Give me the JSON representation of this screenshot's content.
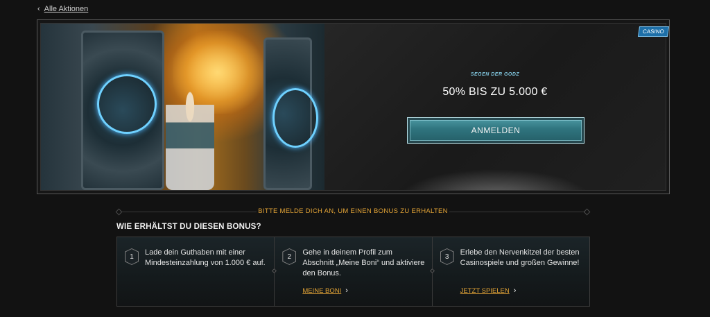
{
  "nav": {
    "back_label": "Alle Aktionen"
  },
  "promo": {
    "badge": "CASINO",
    "subtitle": "SEGEN DER GODZ",
    "headline": "50% BIS ZU 5.000 €",
    "cta_label": "ANMELDEN"
  },
  "notice": "BITTE MELDE DICH AN, UM EINEN BONUS ZU ERHALTEN",
  "how": {
    "title": "WIE ERHÄLTST DU DIESEN BONUS?",
    "steps": [
      {
        "number": "1",
        "text": "Lade dein Guthaben mit einer Mindesteinzahlung von 1.000 € auf.",
        "link": ""
      },
      {
        "number": "2",
        "text": "Gehe in deinem Profil zum Abschnitt „Meine Boni“ und aktiviere den Bonus.",
        "link": "MEINE BONI"
      },
      {
        "number": "3",
        "text": "Erlebe den Nervenkitzel der besten Casinospiele und großen Gewinne!",
        "link": "JETZT SPIELEN"
      }
    ]
  },
  "colors": {
    "accent_gold": "#e2a336",
    "cta_teal": "#2f747e",
    "badge_blue": "#1d6fa8"
  }
}
